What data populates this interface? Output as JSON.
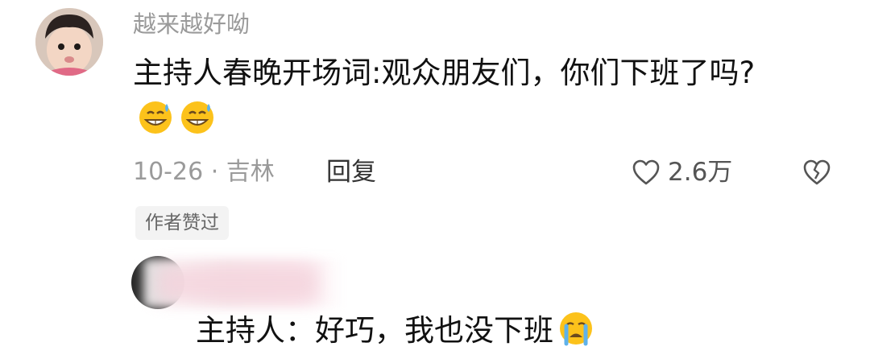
{
  "comment": {
    "username": "越来越好呦",
    "text": "主持人春晚开场词:观众朋友们，你们下班了吗?",
    "emojis": [
      "grinning-sweat-emoji",
      "grinning-sweat-emoji"
    ],
    "date_location": "10-26 · 吉林",
    "reply_label": "回复",
    "like_count": "2.6万",
    "author_badge": "作者赞过"
  },
  "reply": {
    "text": "主持人：好巧，我也没下班",
    "emoji": "crying-face-emoji"
  },
  "icons": {
    "like": "heart-outline-icon",
    "dislike": "broken-heart-icon"
  }
}
